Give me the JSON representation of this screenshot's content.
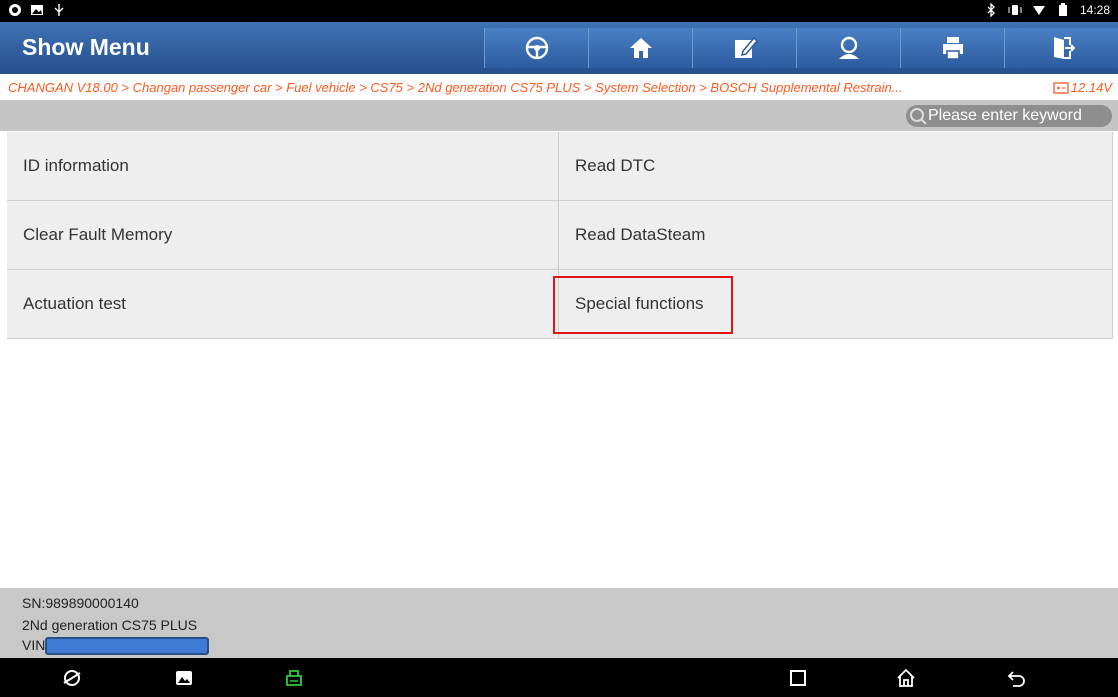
{
  "status_bar": {
    "time": "14:28"
  },
  "header": {
    "title": "Show Menu",
    "toolbar": [
      "steering-wheel-icon",
      "home-icon",
      "edit-icon",
      "user-icon",
      "print-icon",
      "exit-icon"
    ]
  },
  "breadcrumb": {
    "path": "CHANGAN V18.00 > Changan passenger car > Fuel vehicle > CS75 > 2Nd generation CS75 PLUS > System Selection > BOSCH Supplemental Restrain...",
    "voltage": "12.14V"
  },
  "search": {
    "placeholder": "Please enter keyword"
  },
  "menu": {
    "items": [
      {
        "label": "ID information"
      },
      {
        "label": "Read DTC"
      },
      {
        "label": "Clear Fault Memory"
      },
      {
        "label": "Read DataSteam"
      },
      {
        "label": "Actuation test"
      },
      {
        "label": "Special functions"
      }
    ]
  },
  "footer": {
    "sn": "SN:989890000140",
    "model": "2Nd generation CS75 PLUS",
    "vin_label": "VIN"
  },
  "colors": {
    "header_bg": "#2f5f9f",
    "breadcrumb_text": "#ff5a1f",
    "highlight_border": "#e01515",
    "vci_icon": "#2ecc40"
  }
}
